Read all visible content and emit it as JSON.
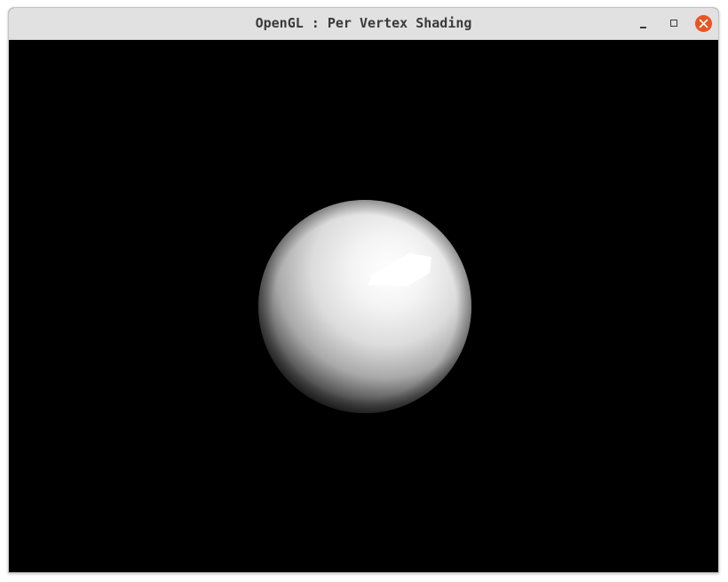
{
  "window": {
    "title": "OpenGL : Per Vertex Shading"
  },
  "controls": {
    "minimize_icon": "minimize-icon",
    "maximize_icon": "maximize-icon",
    "close_icon": "close-icon",
    "close_color": "#e95420"
  },
  "scene": {
    "background_color": "#000000",
    "object": "sphere",
    "object_color": "#ffffff",
    "shading": "per-vertex"
  }
}
